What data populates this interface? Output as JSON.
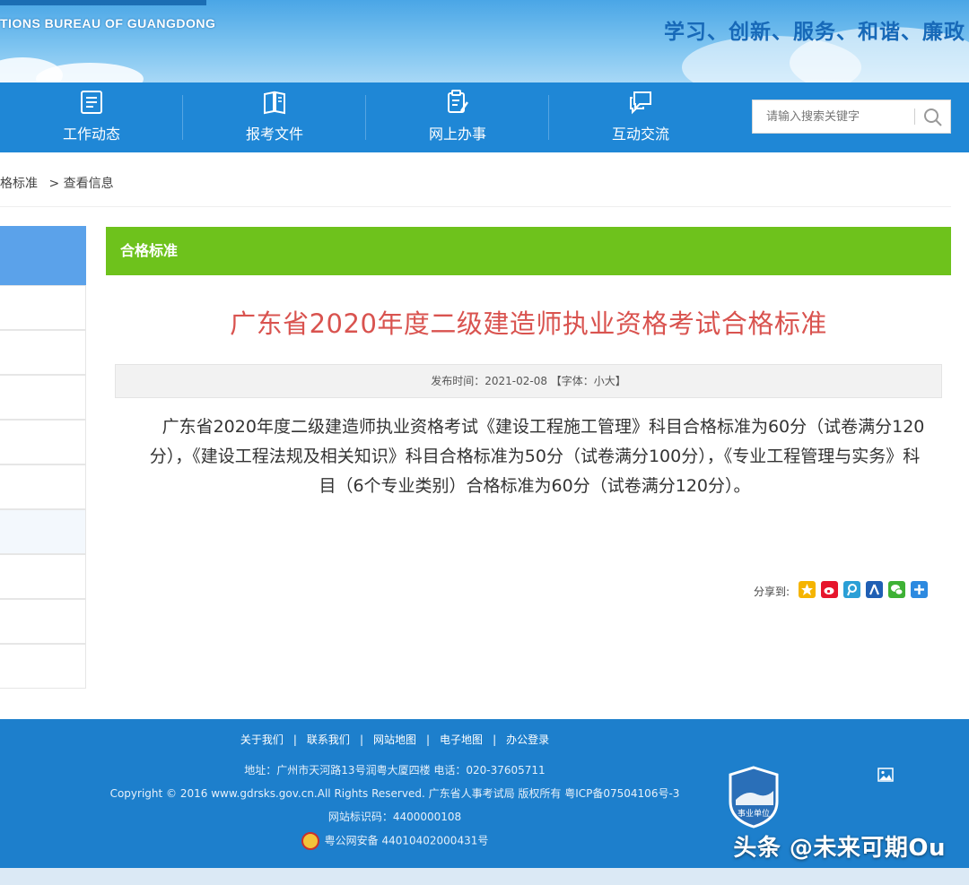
{
  "banner": {
    "english_name": "TIONS BUREAU OF GUANGDONG",
    "motto": "学习、创新、服务、和谐、廉政"
  },
  "nav": {
    "items": [
      {
        "label": "工作动态",
        "icon": "news-list-icon"
      },
      {
        "label": "报考文件",
        "icon": "book-icon"
      },
      {
        "label": "网上办事",
        "icon": "clipboard-edit-icon"
      },
      {
        "label": "互动交流",
        "icon": "chat-bubble-icon"
      }
    ],
    "search": {
      "placeholder": "请输入搜索关键字",
      "icon": "search-icon"
    }
  },
  "breadcrumb": {
    "parent": "格标准",
    "current": "> 查看信息"
  },
  "section": {
    "title": "合格标准"
  },
  "article": {
    "title_prefix": "广东省",
    "title_year": "2020",
    "title_suffix": "年度二级建造师执业资格考试合格标准",
    "meta": "发布时间：2021-02-08 【字体：小大】",
    "body": "广东省2020年度二级建造师执业资格考试《建设工程施工管理》科目合格标准为60分（试卷满分120分），《建设工程法规及相关知识》科目合格标准为50分（试卷满分100分），《专业工程管理与实务》科目（6个专业类别）合格标准为60分（试卷满分120分）。"
  },
  "share": {
    "label": "分享到:",
    "icons": [
      "qzone-icon",
      "weibo-icon",
      "tencent-weibo-icon",
      "renren-icon",
      "wechat-icon",
      "more-share-icon"
    ]
  },
  "footer": {
    "links": [
      "关于我们",
      "联系我们",
      "网站地图",
      "电子地图",
      "办公登录"
    ],
    "link_separator": "|",
    "address": "地址：广州市天河路13号润粤大厦四楼 电话：020-37605711",
    "copyright": "Copyright © 2016 www.gdrsks.gov.cn.All Rights Reserved. 广东省人事考试局 版权所有 粤ICP备07504106号-3",
    "site_id": "网站标识码：4400000108",
    "police_record": "粤公网安备 44010402000431号",
    "badge_text": "事业单位"
  },
  "watermark": "头条 @未来可期Ou",
  "colors": {
    "nav_bg": "#1f87d6",
    "section_bar": "#6ec21c",
    "title_red": "#d9534f",
    "footer_bg": "#1d7fcc",
    "motto_blue": "#1769b8"
  }
}
